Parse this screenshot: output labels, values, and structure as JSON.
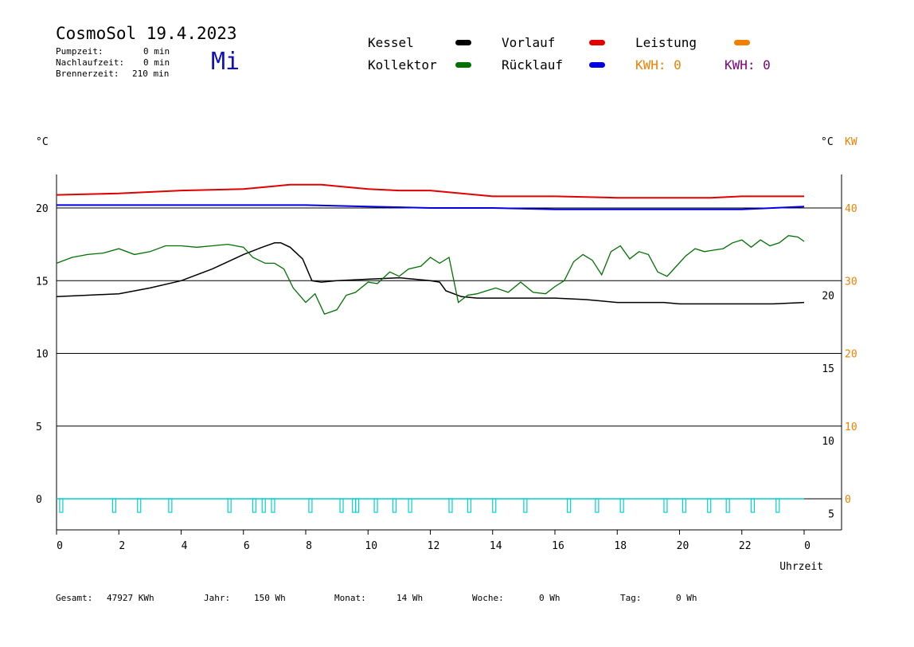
{
  "header": {
    "title": "CosmoSol 19.4.2023",
    "weekday": "Mi",
    "pumpzeit_label": "Pumpzeit:",
    "pumpzeit_value": "0 min",
    "nachlaufzeit_label": "Nachlaufzeit:",
    "nachlaufzeit_value": "0 min",
    "brennerzeit_label": "Brennerzeit:",
    "brennerzeit_value": "210 min"
  },
  "legend": {
    "kessel": "Kessel",
    "kollektor": "Kollektor",
    "vorlauf": "Vorlauf",
    "ruecklauf": "Rücklauf",
    "leistung": "Leistung",
    "kwh_1": "KWH: 0",
    "kwh_2": "KWH: 0"
  },
  "colors": {
    "kessel": "#000000",
    "kollektor": "#007000",
    "vorlauf": "#e00000",
    "ruecklauf": "#0000e0",
    "leistung": "#f08000",
    "kwh_2": "#800080",
    "pump": "#00d0d0",
    "weekday": "#1010c0"
  },
  "footer": {
    "gesamt_label": "Gesamt:",
    "gesamt_value": "47927 KWh",
    "jahr_label": "Jahr:",
    "jahr_value": "150 Wh",
    "monat_label": "Monat:",
    "monat_value": "14 Wh",
    "woche_label": "Woche:",
    "woche_value": "0 Wh",
    "tag_label": "Tag:",
    "tag_value": "0 Wh"
  },
  "chart_data": {
    "type": "line",
    "xlabel": "Uhrzeit",
    "x_ticks": [
      "0",
      "2",
      "4",
      "6",
      "8",
      "10",
      "12",
      "14",
      "16",
      "18",
      "20",
      "22",
      "0"
    ],
    "xlim": [
      0,
      24
    ],
    "y_left_unit": "°C",
    "y_left_ticks": [
      "0",
      "5",
      "10",
      "15",
      "20"
    ],
    "ylim_left": [
      0,
      25
    ],
    "y_right_unit": "°C",
    "y_right_ticks": [
      "5",
      "10",
      "15",
      "20"
    ],
    "ylim_right": [
      -6,
      24
    ],
    "y_right2_unit": "KW",
    "y_right2_ticks": [
      "0",
      "10",
      "20",
      "30",
      "40"
    ],
    "ylim_right2": [
      0,
      50
    ],
    "grid_lines_left": [
      0,
      5,
      10,
      15,
      20
    ],
    "series": [
      {
        "name": "Vorlauf",
        "axis": "left",
        "x": [
          0,
          2,
          4,
          6,
          7,
          7.5,
          8,
          8.5,
          9,
          10,
          11,
          12,
          13,
          14,
          16,
          18,
          19,
          20,
          21,
          22,
          24
        ],
        "y": [
          20.9,
          21.0,
          21.2,
          21.3,
          21.5,
          21.6,
          21.6,
          21.6,
          21.5,
          21.3,
          21.2,
          21.2,
          21.0,
          20.8,
          20.8,
          20.7,
          20.7,
          20.7,
          20.7,
          20.8,
          20.8
        ]
      },
      {
        "name": "Rücklauf",
        "axis": "left",
        "x": [
          0,
          2,
          4,
          6,
          8,
          10,
          12,
          13,
          14,
          16,
          18,
          20,
          22,
          24
        ],
        "y": [
          20.2,
          20.2,
          20.2,
          20.2,
          20.2,
          20.1,
          20.0,
          20.0,
          20.0,
          19.9,
          19.9,
          19.9,
          19.9,
          20.1
        ]
      },
      {
        "name": "Kessel",
        "axis": "left",
        "x": [
          0,
          1,
          2,
          3,
          4,
          5,
          6,
          6.6,
          7.0,
          7.2,
          7.5,
          7.9,
          8.2,
          8.5,
          9,
          10,
          11,
          11.5,
          12,
          12.3,
          12.5,
          13,
          13.5,
          14,
          15,
          16,
          17,
          17.5,
          18,
          19,
          19.5,
          20,
          21,
          22,
          23,
          24
        ],
        "y": [
          13.9,
          14.0,
          14.1,
          14.5,
          15.0,
          15.8,
          16.8,
          17.3,
          17.6,
          17.6,
          17.3,
          16.5,
          15.0,
          14.9,
          15.0,
          15.1,
          15.2,
          15.1,
          15.0,
          14.9,
          14.3,
          13.9,
          13.8,
          13.8,
          13.8,
          13.8,
          13.7,
          13.6,
          13.5,
          13.5,
          13.5,
          13.4,
          13.4,
          13.4,
          13.4,
          13.5
        ]
      },
      {
        "name": "Kollektor",
        "axis": "left",
        "x": [
          0,
          0.5,
          1,
          1.5,
          2,
          2.5,
          3,
          3.5,
          4,
          4.5,
          5,
          5.5,
          6,
          6.3,
          6.7,
          7,
          7.3,
          7.6,
          8,
          8.3,
          8.6,
          9,
          9.3,
          9.6,
          10,
          10.3,
          10.7,
          11,
          11.3,
          11.7,
          12,
          12.3,
          12.6,
          12.9,
          13.2,
          13.5,
          13.8,
          14.1,
          14.5,
          14.9,
          15.3,
          15.7,
          16,
          16.3,
          16.6,
          16.9,
          17.2,
          17.5,
          17.8,
          18.1,
          18.4,
          18.7,
          19,
          19.3,
          19.6,
          19.9,
          20.2,
          20.5,
          20.8,
          21.1,
          21.4,
          21.7,
          22,
          22.3,
          22.6,
          22.9,
          23.2,
          23.5,
          23.8,
          24
        ],
        "y": [
          16.2,
          16.6,
          16.8,
          16.9,
          17.2,
          16.8,
          17.0,
          17.4,
          17.4,
          17.3,
          17.4,
          17.5,
          17.3,
          16.6,
          16.2,
          16.2,
          15.8,
          14.5,
          13.5,
          14.1,
          12.7,
          13.0,
          14.0,
          14.2,
          14.9,
          14.8,
          15.6,
          15.3,
          15.8,
          16.0,
          16.6,
          16.2,
          16.6,
          13.5,
          14.0,
          14.1,
          14.3,
          14.5,
          14.2,
          14.9,
          14.2,
          14.1,
          14.6,
          15.0,
          16.3,
          16.8,
          16.4,
          15.4,
          17.0,
          17.4,
          16.5,
          17.0,
          16.8,
          15.6,
          15.3,
          16.0,
          16.7,
          17.2,
          17.0,
          17.1,
          17.2,
          17.6,
          17.8,
          17.3,
          17.8,
          17.4,
          17.6,
          18.1,
          18.0,
          17.7
        ]
      }
    ],
    "pump_on_hours": [
      0.1,
      1.8,
      2.6,
      3.6,
      5.5,
      6.3,
      6.6,
      6.9,
      8.1,
      9.1,
      9.5,
      9.6,
      10.2,
      10.8,
      11.3,
      12.6,
      13.2,
      14.0,
      15.0,
      16.4,
      17.3,
      18.1,
      19.5,
      20.1,
      20.9,
      21.5,
      22.3,
      23.1
    ]
  }
}
